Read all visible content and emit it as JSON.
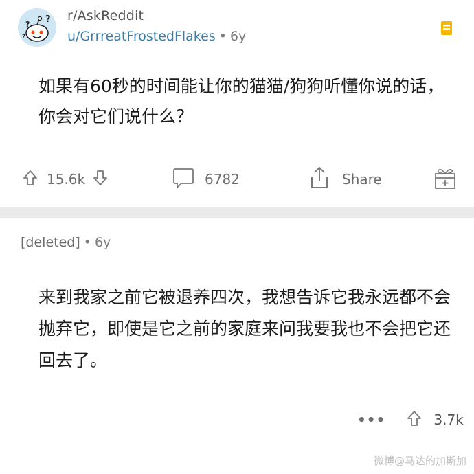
{
  "post": {
    "subreddit": "r/AskReddit",
    "author": "u/GrrreatFrostedFlakes",
    "age": "6y",
    "separator": "•",
    "title": "如果有60秒的时间能让你的猫猫/狗狗听懂你说的话，你会对它们说什么？",
    "upvotes": "15.6k",
    "comments": "6782",
    "share_label": "Share",
    "icons": {
      "avatar": "reddit-snoo-question-avatar-icon",
      "save": "bookmark-icon",
      "upvote": "arrow-up-icon",
      "downvote": "arrow-down-icon",
      "comment": "comment-bubble-icon",
      "share": "share-icon",
      "award": "gift-award-icon"
    },
    "colors": {
      "author_link": "#3b7ea8",
      "save_icon": "#f5b800",
      "avatar_bg": "#cfe6f4"
    }
  },
  "comment": {
    "author": "[deleted]",
    "separator": "•",
    "age": "6y",
    "body": "来到我家之前它被退养四次，我想告诉它我永远都不会抛弃它，即使是它之前的家庭来问我要我也不会把它还回去了。",
    "more": "•••",
    "score": "3.7k",
    "icons": {
      "more": "more-dots-icon",
      "upvote": "arrow-up-icon"
    }
  },
  "watermark": "微博@马达的加斯加"
}
